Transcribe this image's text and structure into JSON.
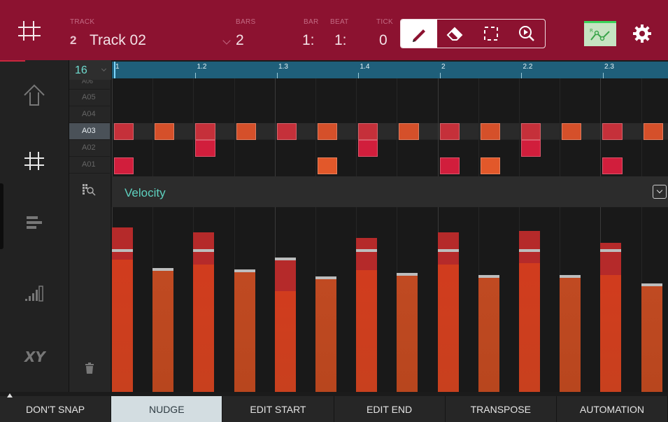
{
  "header": {
    "track_label": "TRACK",
    "track_number": "2",
    "track_name": "Track 02",
    "bars_label": "BARS",
    "bars_value": "2",
    "bar_label": "BAR",
    "bar_value": "1:",
    "beat_label": "BEAT",
    "beat_value": "1:",
    "tick_label": "TICK",
    "tick_value": "0",
    "tools": [
      "pencil-icon",
      "eraser-icon",
      "select-icon",
      "zoom-icon"
    ],
    "active_tool": "pencil"
  },
  "grid": {
    "resolution": "16",
    "pads": [
      "A06",
      "A05",
      "A04",
      "A03",
      "A02",
      "A01"
    ],
    "selected_pad": "A03"
  },
  "timeline": {
    "markers": [
      "1",
      "1.2",
      "1.3",
      "1.4",
      "2",
      "2.2",
      "2.3"
    ]
  },
  "notes": {
    "A03": [
      0,
      1,
      2,
      3,
      4,
      5,
      6,
      7,
      8,
      9,
      10,
      11,
      12,
      13
    ],
    "A02": [
      2,
      6,
      10
    ],
    "A01": [
      0,
      5,
      8,
      9,
      12
    ]
  },
  "velocity": {
    "title": "Velocity",
    "levels": [
      0.94,
      0.7,
      0.91,
      0.69,
      0.76,
      0.65,
      0.88,
      0.67,
      0.91,
      0.66,
      0.92,
      0.66,
      0.85,
      0.61
    ]
  },
  "bottom_bar": {
    "buttons": [
      "DON'T SNAP",
      "NUDGE",
      "EDIT START",
      "EDIT END",
      "TRANSPOSE",
      "AUTOMATION"
    ],
    "active": "NUDGE"
  },
  "colors": {
    "header_bg": "#8c1230",
    "note_red": "#c8283e",
    "note_orange": "#d9502a",
    "velocity_teal": "#5ed1bf",
    "timeline_bg": "#1f5f7a"
  }
}
